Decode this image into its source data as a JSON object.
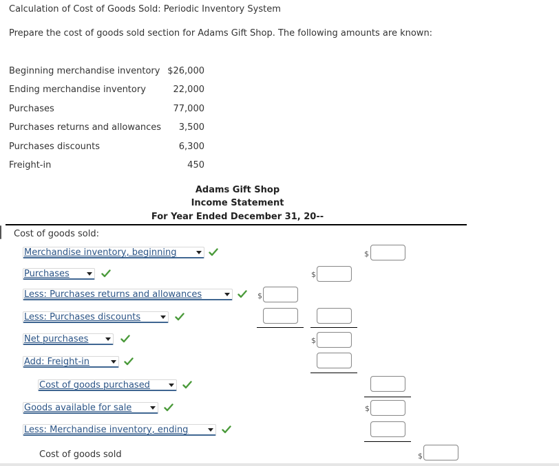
{
  "page": {
    "title": "Calculation of Cost of Goods Sold: Periodic Inventory System",
    "instructions": "Prepare the cost of goods sold section for Adams Gift Shop. The following amounts are known:"
  },
  "given": [
    {
      "label": "Beginning merchandise inventory",
      "value": "$26,000"
    },
    {
      "label": "Ending merchandise inventory",
      "value": "22,000"
    },
    {
      "label": "Purchases",
      "value": "77,000"
    },
    {
      "label": "Purchases returns and allowances",
      "value": "3,500"
    },
    {
      "label": "Purchases discounts",
      "value": "6,300"
    },
    {
      "label": "Freight-in",
      "value": "450"
    }
  ],
  "statement": {
    "company": "Adams Gift Shop",
    "name": "Income Statement",
    "period": "For Year Ended December 31, 20--",
    "section_label": "Cost of goods sold:",
    "final_label": "Cost of goods sold",
    "rows": [
      {
        "selected": "Merchandise inventory, beginning",
        "status": "correct"
      },
      {
        "selected": "Purchases",
        "status": "correct"
      },
      {
        "selected": "Less: Purchases returns and allowances",
        "status": "correct"
      },
      {
        "selected": "Less: Purchases discounts",
        "status": "correct"
      },
      {
        "selected": "Net purchases",
        "status": "correct"
      },
      {
        "selected": "Add: Freight-in",
        "status": "correct"
      },
      {
        "selected": "Cost of goods purchased",
        "status": "correct"
      },
      {
        "selected": "Goods available for sale",
        "status": "correct"
      },
      {
        "selected": "Less: Merchandise inventory, ending",
        "status": "correct"
      }
    ],
    "currency_symbol": "$",
    "inputs": {
      "beginning_inventory": "",
      "purchases": "",
      "returns_allowances": "",
      "purchase_discounts": "",
      "discounts_total": "",
      "net_purchases": "",
      "freight_in": "",
      "cost_of_goods_purchased": "",
      "goods_available": "",
      "ending_inventory": "",
      "cost_of_goods_sold": ""
    }
  },
  "colors": {
    "select_text": "#2b5486",
    "select_underline": "#3e6591",
    "check": "#4a9a3a"
  }
}
